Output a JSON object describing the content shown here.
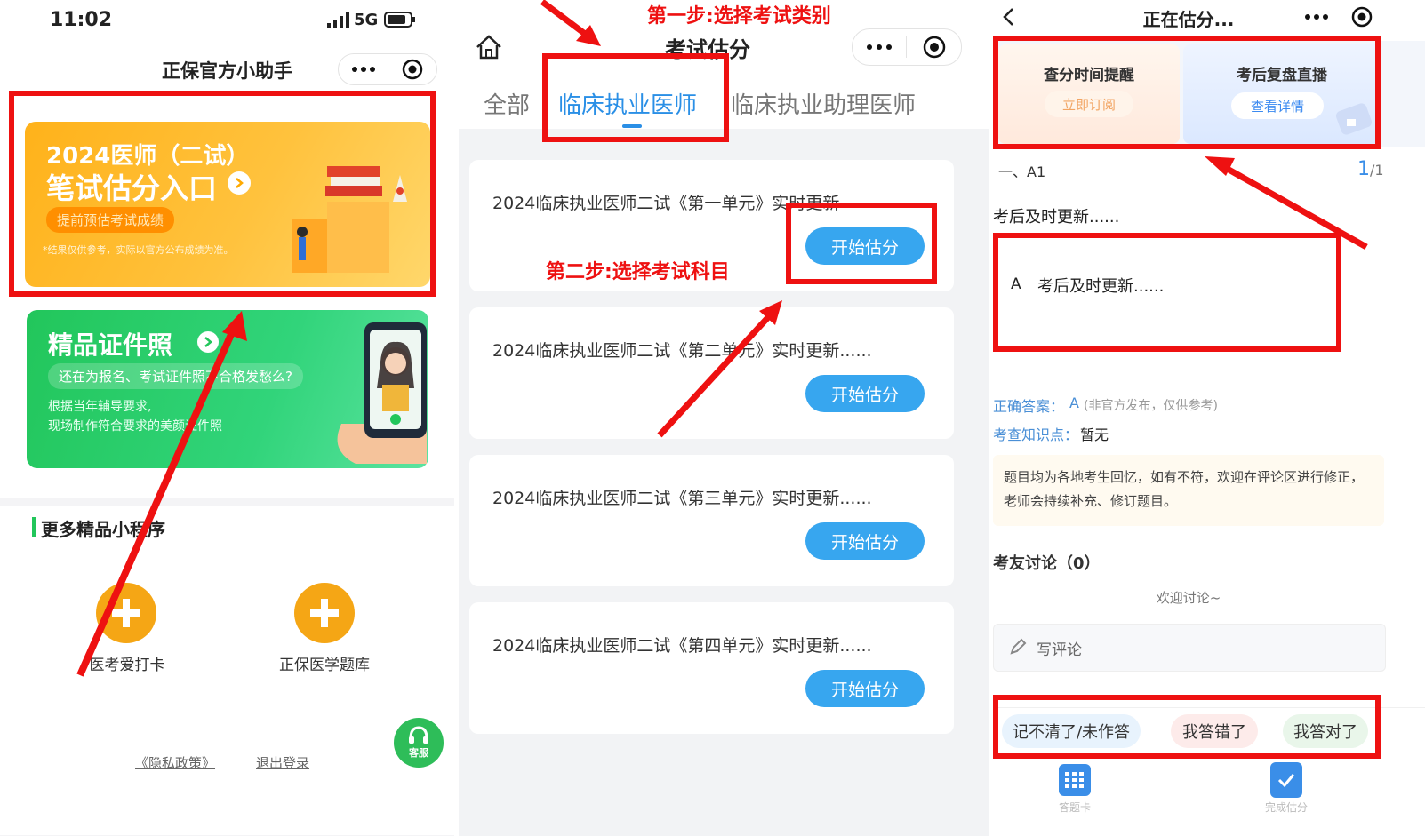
{
  "panel1": {
    "status_time": "11:02",
    "status_network": "5G",
    "nav_title": "正保官方小助手",
    "banner1": {
      "line1": "2024医师（二试）",
      "line2": "笔试估分入口",
      "tag": "提前预估考试成绩",
      "note": "*结果仅供参考，实际以官方公布成绩为准。"
    },
    "banner2": {
      "title": "精品证件照",
      "subtitle": "还在为报名、考试证件照不合格发愁么?",
      "desc1": "根据当年辅导要求,",
      "desc2": "现场制作符合要求的美颜证件照"
    },
    "more_title": "更多精品小程序",
    "apps": [
      {
        "label": "医考爱打卡"
      },
      {
        "label": "正保医学题库"
      }
    ],
    "footer_links": [
      "《隐私政策》",
      "退出登录"
    ],
    "service_label": "客服"
  },
  "panel2": {
    "step1": "第一步:选择考试类别",
    "step2": "第二步:选择考试科目",
    "nav_title": "考试估分",
    "tabs": [
      "全部",
      "临床执业医师",
      "临床执业助理医师"
    ],
    "active_tab": "临床执业医师",
    "items": [
      {
        "title": "2024临床执业医师二试《第一单元》实时更新",
        "button": "开始估分"
      },
      {
        "title": "2024临床执业医师二试《第二单元》实时更新......",
        "button": "开始估分"
      },
      {
        "title": "2024临床执业医师二试《第三单元》实时更新......",
        "button": "开始估分"
      },
      {
        "title": "2024临床执业医师二试《第四单元》实时更新......",
        "button": "开始估分"
      }
    ]
  },
  "panel3": {
    "nav_title": "正在估分...",
    "card1": {
      "title": "查分时间提醒",
      "button": "立即订阅"
    },
    "card2": {
      "title": "考后复盘直播",
      "button": "查看详情"
    },
    "section": "一、A1",
    "page_current": "1",
    "page_total": "/1",
    "question": "考后及时更新......",
    "option_letter": "A",
    "option_text": "考后及时更新......",
    "answer_label": "正确答案：",
    "answer_value": "A",
    "answer_note": "(非官方发布，仅供参考)",
    "knowledge_label": "考查知识点：",
    "knowledge_value": "暂无",
    "notice": "题目均为各地考生回忆，如有不符，欢迎在评论区进行修正，老师会持续补充、修订题目。",
    "discussion_title": "考友讨论（0）",
    "discussion_empty": "欢迎讨论~",
    "comment_placeholder": "写评论",
    "choices": [
      "记不清了/未作答",
      "我答错了",
      "我答对了"
    ],
    "tabbar": [
      "答题卡",
      "完成估分"
    ]
  },
  "colors": {
    "annotation_red": "#ee1111",
    "primary_blue": "#37a6ef",
    "orange": "#ffb21a",
    "green": "#22c65b"
  }
}
